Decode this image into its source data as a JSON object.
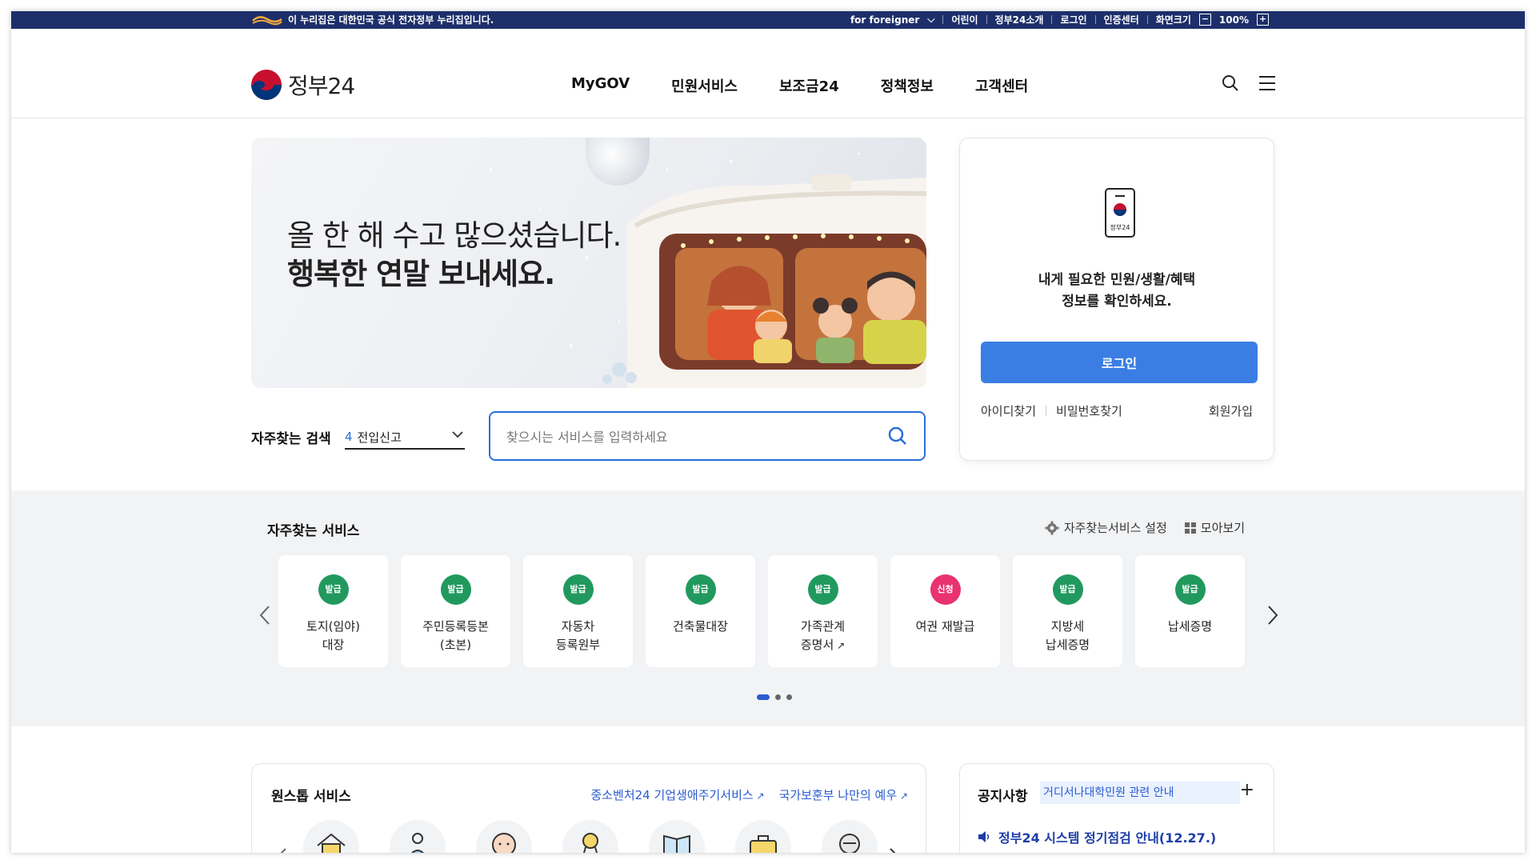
{
  "topbar": {
    "gov_notice": "이 누리집은 대한민국 공식 전자정부 누리집입니다.",
    "foreigner": "for foreigner",
    "lang": "어린이",
    "intro": "정부24소개",
    "login": "로그인",
    "cert": "인증센터",
    "zoom_label": "화면크기",
    "zoom_minus": "−",
    "zoom_value": "100%",
    "zoom_plus": "+"
  },
  "header": {
    "logo_text": "정부24",
    "nav": [
      "MyGOV",
      "민원서비스",
      "보조금24",
      "정책정보",
      "고객센터"
    ]
  },
  "hero": {
    "line1": "올 한 해 수고 많으셨습니다.",
    "line2": "행복한 연말 보내세요."
  },
  "search": {
    "label": "자주찾는 검색",
    "select_num": "4",
    "select_value": "전입신고",
    "placeholder": "찾으시는 서비스를 입력하세요"
  },
  "login_card": {
    "phone_label": "정부24",
    "msg1": "내게 필요한 민원/생활/혜택",
    "msg2": "정보를 확인하세요.",
    "button": "로그인",
    "find_id": "아이디찾기",
    "find_pw": "비밀번호찾기",
    "join": "회원가입"
  },
  "freq": {
    "title": "자주찾는 서비스",
    "settings": "자주찾는서비스 설정",
    "view_all": "모아보기",
    "services": [
      {
        "badge": "발급",
        "line1": "토지(임야)",
        "line2": "대장"
      },
      {
        "badge": "발급",
        "line1": "주민등록등본",
        "line2": "(초본)"
      },
      {
        "badge": "발급",
        "line1": "자동차",
        "line2": "등록원부"
      },
      {
        "badge": "발급",
        "line1": "건축물대장",
        "line2": ""
      },
      {
        "badge": "발급",
        "line1": "가족관계",
        "line2": "증명서"
      },
      {
        "badge": "신청",
        "line1": "여권 재발급",
        "line2": ""
      },
      {
        "badge": "발급",
        "line1": "지방세",
        "line2": "납세증명"
      },
      {
        "badge": "발급",
        "line1": "납세증명",
        "line2": ""
      }
    ]
  },
  "onestop": {
    "title": "원스톱 서비스",
    "link1": "중소벤처24 기업생애주기서비스",
    "link2": "국가보훈부 나만의 예우"
  },
  "notice": {
    "title": "공지사항",
    "tag": "거디서나대학민원 관련 안내",
    "plus": "+",
    "item": "정부24 시스템 정기점검 안내(12.27.)"
  },
  "colors": {
    "topbar": "#1d2f6b",
    "accent": "#3a7ee4",
    "badge_green": "#21995e",
    "badge_red": "#e8336f"
  }
}
